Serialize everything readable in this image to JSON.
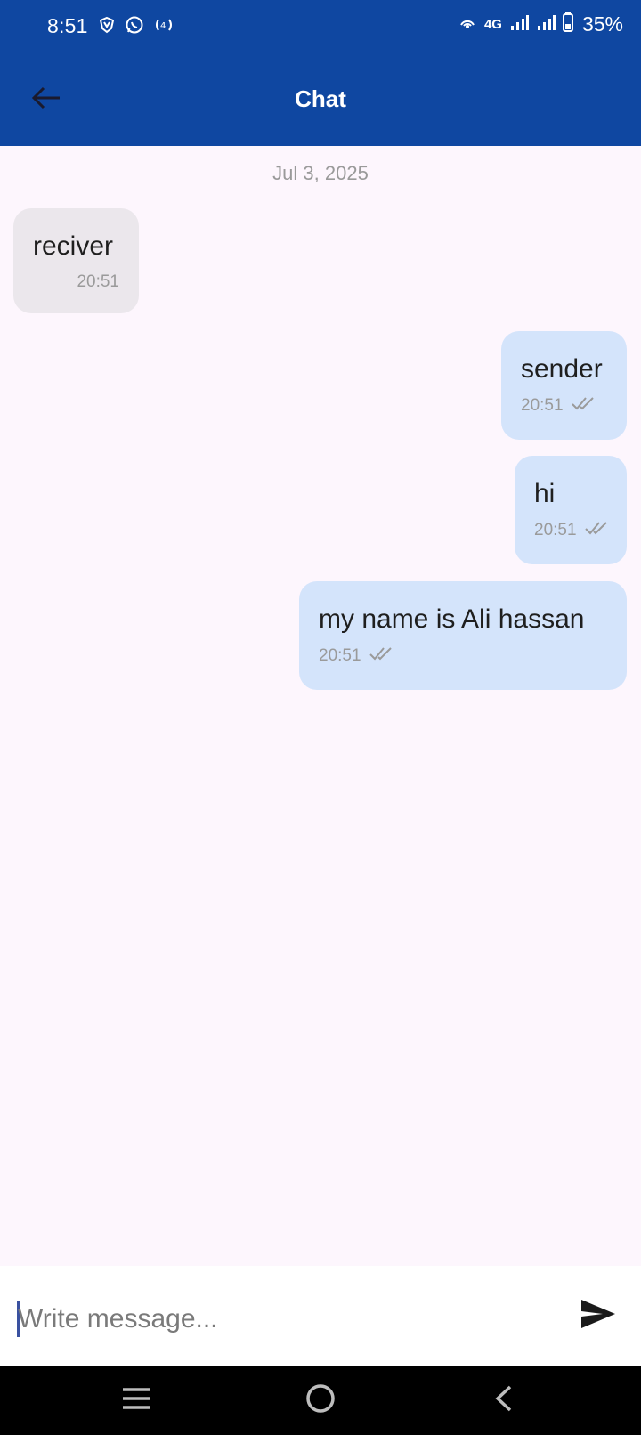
{
  "status_bar": {
    "time": "8:51",
    "network": "4G",
    "battery": "35%",
    "icons": [
      "vpn-shield-icon",
      "whatsapp-icon",
      "hotspot-icon",
      "wifi-calling-icon",
      "signal-icon",
      "signal-icon",
      "battery-icon"
    ]
  },
  "app_bar": {
    "title": "Chat",
    "back_icon": "arrow-left-icon",
    "color": "#0f47a1"
  },
  "chat": {
    "date_separator": "Jul 3, 2025",
    "messages": [
      {
        "direction": "received",
        "text": "reciver",
        "time": "20:51"
      },
      {
        "direction": "sent",
        "text": "sender",
        "time": "20:51",
        "status": "double-check-icon"
      },
      {
        "direction": "sent",
        "text": "hi",
        "time": "20:51",
        "status": "double-check-icon"
      },
      {
        "direction": "sent",
        "text": "my name is Ali hassan",
        "time": "20:51",
        "status": "double-check-icon"
      }
    ],
    "colors": {
      "received_bubble": "#ebe7ec",
      "sent_bubble": "#d4e4fb",
      "background": "#fdf6fd"
    }
  },
  "input": {
    "placeholder": "Write message...",
    "value": "",
    "send_icon": "send-icon"
  },
  "nav_bar": {
    "icons": [
      "recent-apps-icon",
      "home-icon",
      "back-icon"
    ]
  }
}
